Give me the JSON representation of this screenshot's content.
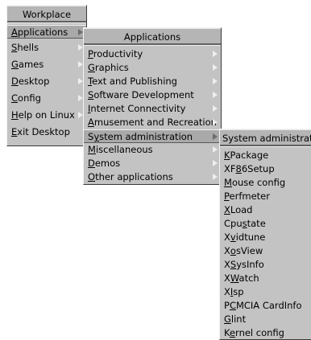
{
  "main_menu": {
    "title": "Workplace",
    "items": [
      {
        "label": "Applications",
        "mnemonic": "A"
      },
      {
        "label": "Shells",
        "mnemonic": "S"
      },
      {
        "label": "Games",
        "mnemonic": "G"
      },
      {
        "label": "Desktop",
        "mnemonic": "D"
      },
      {
        "label": "Config",
        "mnemonic": "C"
      },
      {
        "label": "Help on Linux",
        "mnemonic": "H"
      },
      {
        "label": "Exit Desktop",
        "mnemonic": "E"
      }
    ]
  },
  "applications_menu": {
    "title": "Applications",
    "items": [
      {
        "label": "Productivity",
        "mnemonic": "P"
      },
      {
        "label": "Graphics",
        "mnemonic": "G"
      },
      {
        "label": "Text and Publishing",
        "mnemonic": "T"
      },
      {
        "label": "Software Development",
        "mnemonic": "S"
      },
      {
        "label": "Internet Connectivity",
        "mnemonic": "I"
      },
      {
        "label": "Amusement and Recreation",
        "mnemonic": "A"
      },
      {
        "label": "System administration",
        "mnemonic": "y"
      },
      {
        "label": "Miscellaneous",
        "mnemonic": "M"
      },
      {
        "label": "Demos",
        "mnemonic": "D"
      },
      {
        "label": "Other applications",
        "mnemonic": "O"
      }
    ]
  },
  "sysadmin_menu": {
    "title": "System administration",
    "items": [
      {
        "label": "KPackage",
        "mnemonic": "K"
      },
      {
        "label": "XF86Setup",
        "mnemonic": "8"
      },
      {
        "label": "Mouse config",
        "mnemonic": "M"
      },
      {
        "label": "Perfmeter",
        "mnemonic": "P"
      },
      {
        "label": "XLoad",
        "mnemonic": "X"
      },
      {
        "label": "Cpustate",
        "mnemonic": "s"
      },
      {
        "label": "Xvidtune",
        "mnemonic": "v"
      },
      {
        "label": "XosView",
        "mnemonic": "o"
      },
      {
        "label": "XSysInfo",
        "mnemonic": "S"
      },
      {
        "label": "XWatch",
        "mnemonic": "W"
      },
      {
        "label": "XIsp",
        "mnemonic": "I"
      },
      {
        "label": "PCMCIA CardInfo",
        "mnemonic": "C"
      },
      {
        "label": "Glint",
        "mnemonic": "G"
      },
      {
        "label": "Kernel config",
        "mnemonic": "e"
      }
    ]
  }
}
